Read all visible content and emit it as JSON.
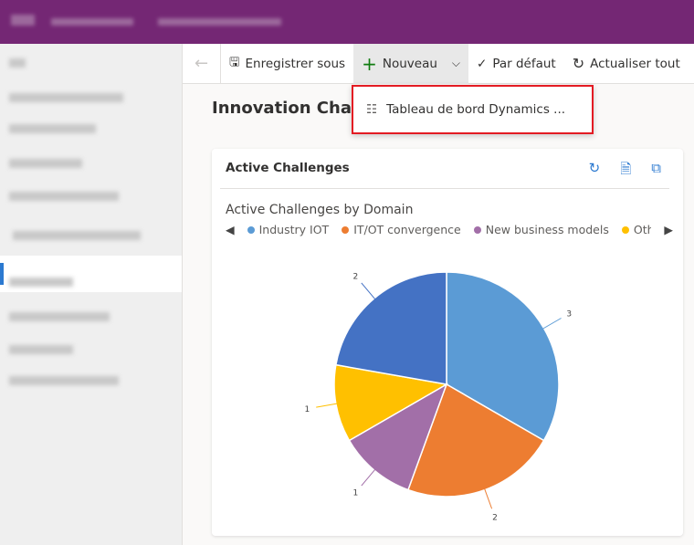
{
  "toolbar": {
    "save_as": "Enregistrer sous",
    "new": "Nouveau",
    "default": "Par défaut",
    "refresh_all": "Actualiser tout"
  },
  "page_title": "Innovation Challe",
  "dropdown": {
    "item": "Tableau de bord Dynamics ..."
  },
  "card": {
    "title": "Active Challenges"
  },
  "chart_data": {
    "type": "pie",
    "title": "Active Challenges by Domain",
    "legend_position": "top",
    "categories": [
      "Industry IOT",
      "IT/OT convergence",
      "New business models",
      "Other",
      ""
    ],
    "values": [
      3,
      2,
      1,
      1,
      2
    ],
    "colors": [
      "#5b9bd5",
      "#ed7d31",
      "#a26fa8",
      "#ffc000",
      "#4472c4"
    ]
  }
}
